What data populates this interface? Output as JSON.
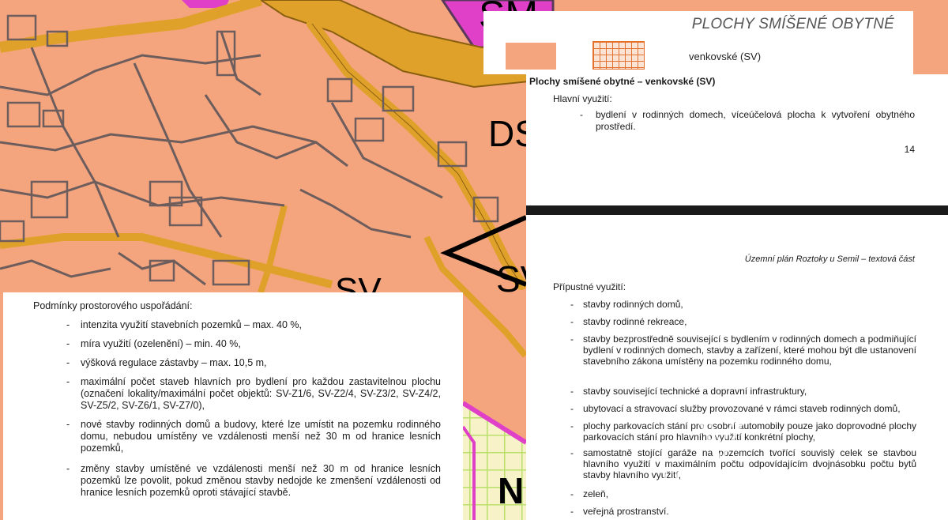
{
  "map": {
    "zone_labels": [
      "SM",
      "DS",
      "SV",
      "SV",
      "N"
    ],
    "colors": {
      "residential": "#f4a57e",
      "road": "#e0a12a",
      "parcel_line": "#6d5d5d",
      "magenta": "#e040c8",
      "green_grid": "#b9e06a"
    }
  },
  "legend": {
    "title": "PLOCHY SMÍŠENÉ OBYTNÉ",
    "label": "venkovské (SV)"
  },
  "doc_top": {
    "heading": "Plochy smíšené obytné – venkovské (SV)",
    "subheading": "Hlavní využití:",
    "dash": "-",
    "bullet": "bydlení v rodinných domech, víceúčelová plocha k vytvoření obytného prostředí.",
    "page_number": "14"
  },
  "doc_bottom": {
    "header": "Územní plán Roztoky u Semil – textová část",
    "subheading": "Přípustné využití:",
    "items": [
      "stavby rodinných domů,",
      "stavby rodinné rekreace,",
      "stavby bezprostředně související s bydlením v rodinných domech a podmiňující bydlení v rodinných domech, stavby a zařízení, které mohou být dle ustanovení stavebního zákona umístěny na pozemku rodinného domu,",
      "stavby související technické a dopravní infrastruktury,",
      "ubytovací a stravovací služby provozované v rámci staveb rodinných domů,",
      "plochy parkovacích stání pro osobní automobily pouze jako doprovodné plochy parkovacích stání pro hlavního využití konkrétní plochy,",
      "samostatně stojící garáže na pozemcích tvořící souvislý celek se stavbou hlavního využití v maximálním počtu odpovídajícím dvojnásobku počtu bytů stavby hlavního využití,",
      "zeleň,",
      "veřejná prostranství."
    ]
  },
  "doc_left": {
    "subheading": "Podmínky prostorového uspořádání:",
    "items": [
      "intenzita využití stavebních pozemků – max. 40 %,",
      "míra využití (ozelenění) – min. 40 %,",
      "výšková regulace zástavby – max. 10,5 m,",
      "maximální počet staveb hlavních pro bydlení pro každou zastavitelnou plochu (označení lokality/maximální počet objektů: SV-Z1/6, SV-Z2/4, SV-Z3/2, SV-Z4/2, SV-Z5/2, SV-Z6/1, SV-Z7/0),",
      "nové stavby rodinných domů a budovy, které lze umístit na pozemku rodinného domu, nebudou umístěny ve vzdálenosti menší než 30 m od hranice lesních pozemků,",
      "změny stavby umístěné ve vzdálenosti menší než 30 m od hranice lesních pozemků lze povolit, pokud změnou stavby nedojde ke zmenšení vzdálenosti od hranice lesních pozemků oproti stávající stavbě."
    ]
  },
  "watermarks": {
    "viagem": "VIAGEM",
    "bazos": "@( Bazos.cz"
  }
}
